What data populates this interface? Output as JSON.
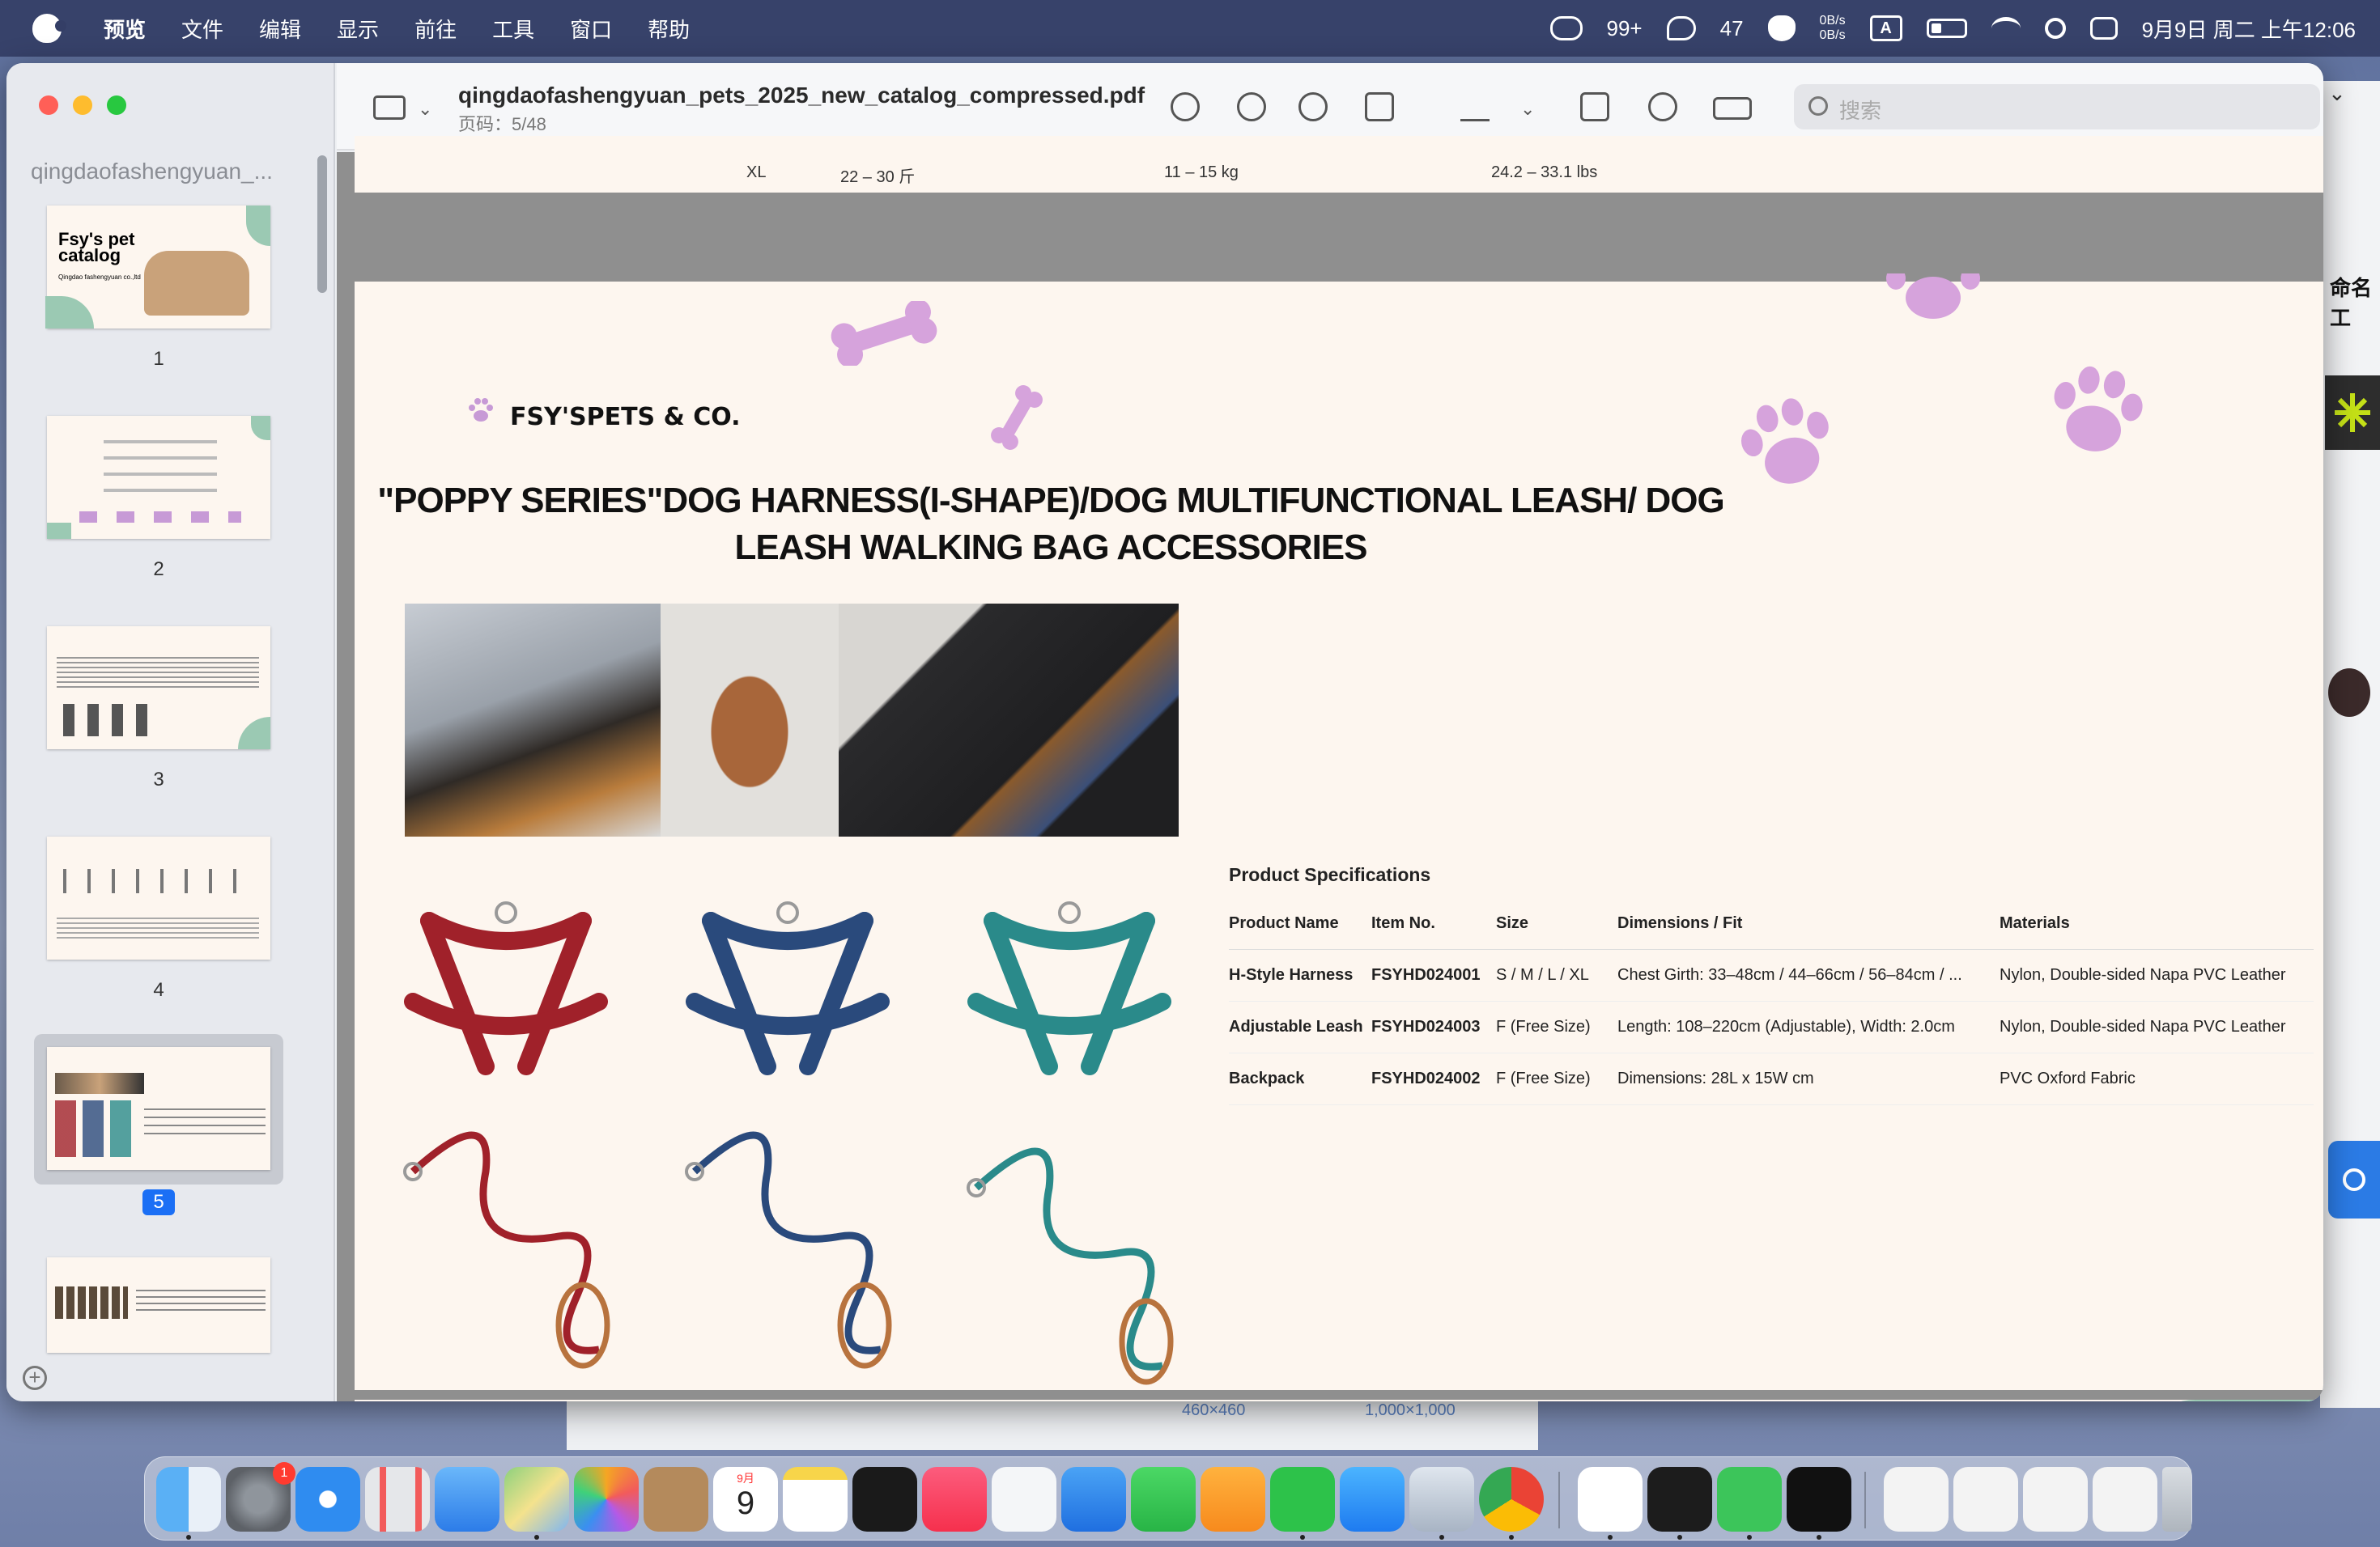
{
  "menubar": {
    "items": [
      "预览",
      "文件",
      "编辑",
      "显示",
      "前往",
      "工具",
      "窗口",
      "帮助"
    ],
    "wechat_count": "99+",
    "chat_count": "47",
    "net_up": "0B/s",
    "net_down": "0B/s",
    "input_method": "A",
    "datetime": "9月9日 周二 上午12:06"
  },
  "sidebar": {
    "title": "qingdaofashengyuan_...",
    "thumb1_title": "Fsy's pet catalog",
    "thumb1_subtitle": "Qingdao fashengyuan co.,ltd",
    "pages": [
      "1",
      "2",
      "3",
      "4",
      "5"
    ],
    "selected_page": "5"
  },
  "toolbar": {
    "title": "qingdaofashengyuan_pets_2025_new_catalog_compressed.pdf",
    "page_info": "页码：5/48",
    "search_placeholder": "搜索"
  },
  "page4_tail": {
    "size": "XL",
    "jin": "22 – 30 斤",
    "kg": "11 – 15 kg",
    "lbs": "24.2 – 33.1 lbs"
  },
  "page5": {
    "brand": "FSY'SPETS & CO.",
    "title_line1": "\"POPPY SERIES\"DOG HARNESS(I-SHAPE)/DOG MULTIFUNCTIONAL LEASH/ DOG",
    "title_line2": "LEASH WALKING BAG ACCESSORIES",
    "spec_title": "Product Specifications",
    "spec_headers": [
      "Product Name",
      "Item No.",
      "Size",
      "Dimensions / Fit",
      "Materials"
    ],
    "spec_rows": [
      [
        "H-Style Harness",
        "FSYHD024001",
        "S / M / L / XL",
        "Chest Girth: 33–48cm / 44–66cm / 56–84cm / ...",
        "Nylon, Double-sided Napa PVC Leather"
      ],
      [
        "Adjustable Leash",
        "FSYHD024003",
        "F (Free Size)",
        "Length: 108–220cm (Adjustable), Width: 2.0cm",
        "Nylon, Double-sided Napa PVC Leather"
      ],
      [
        "Backpack",
        "FSYHD024002",
        "F (Free Size)",
        "Dimensions: 28L x 15W cm",
        "PVC Oxford Fabric"
      ]
    ],
    "product_colors": [
      "#a0212a",
      "#2a4a7c",
      "#2a8a8a"
    ]
  },
  "right_edge": {
    "text": "命名工"
  },
  "background_window": {
    "dim1": "460×460",
    "dim2": "1,000×1,000"
  },
  "dock": {
    "calendar_month": "9月",
    "calendar_day": "9",
    "settings_badge": "1",
    "apps": [
      "finder",
      "system-settings",
      "safari",
      "launchpad",
      "mail",
      "maps",
      "photos",
      "contacts",
      "calendar",
      "notes",
      "apple-tv",
      "music",
      "freeform",
      "keynote",
      "numbers",
      "pages",
      "wechat",
      "app-store",
      "preview",
      "chrome",
      "qq",
      "terminal",
      "messages",
      "github"
    ]
  }
}
